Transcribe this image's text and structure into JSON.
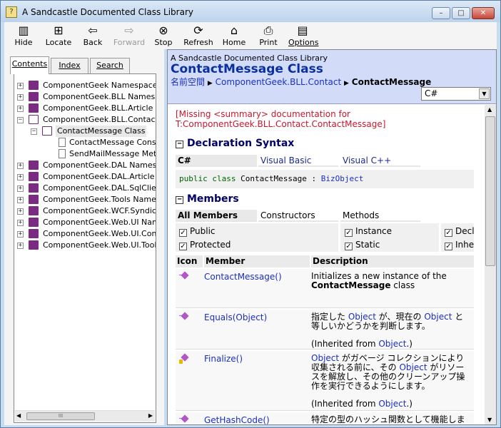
{
  "window": {
    "title": "A Sandcastle Documented Class Library",
    "icon": "help-book-icon",
    "minimize": "–",
    "maximize": "□",
    "close": "✕"
  },
  "toolbar": {
    "hide": "Hide",
    "locate": "Locate",
    "back": "Back",
    "forward": "Forward",
    "stop": "Stop",
    "refresh": "Refresh",
    "home": "Home",
    "print": "Print",
    "options": "Options"
  },
  "nav_tabs": {
    "contents": "Contents",
    "index": "Index",
    "search": "Search"
  },
  "tree": {
    "items": [
      {
        "label": "ComponentGeek Namespace"
      },
      {
        "label": "ComponentGeek.BLL Namespa"
      },
      {
        "label": "ComponentGeek.BLL.Article N"
      },
      {
        "label": "ComponentGeek.BLL.Contact N"
      },
      {
        "label": "ContactMessage Class"
      },
      {
        "label": "ContactMessage Cons"
      },
      {
        "label": "SendMailMessage Meth"
      },
      {
        "label": "ComponentGeek.DAL Namespa"
      },
      {
        "label": "ComponentGeek.DAL.Article N"
      },
      {
        "label": "ComponentGeek.DAL.SqlClient"
      },
      {
        "label": "ComponentGeek.Tools Namesp"
      },
      {
        "label": "ComponentGeek.WCF.Syndicat"
      },
      {
        "label": "ComponentGeek.Web.UI Names"
      },
      {
        "label": "ComponentGeek.Web.UI.Contro"
      },
      {
        "label": "ComponentGeek.Web.UI.Tools"
      }
    ],
    "scroll_grip": "III"
  },
  "topic": {
    "library": "A Sandcastle Documented Class Library",
    "title": "ContactMessage Class",
    "breadcrumb": {
      "root": "名前空間",
      "sep1": "▶",
      "namespace": "ComponentGeek.BLL.Contact",
      "sep2": "▶",
      "current": "ContactMessage"
    },
    "language": "C#",
    "missing": "[Missing <summary> documentation for T:ComponentGeek.BLL.Contact.ContactMessage]",
    "declaration": {
      "heading": "Declaration Syntax",
      "collapse": "−",
      "tabs": [
        "C#",
        "Visual Basic",
        "Visual C++"
      ],
      "code_kw1": "public",
      "code_kw2": "class",
      "code_name": "ContactMessage",
      "code_sep": ":",
      "code_base": "BizObject"
    },
    "members": {
      "heading": "Members",
      "collapse": "−",
      "tabs": [
        "All Members",
        "Constructors",
        "Methods"
      ],
      "filters": {
        "public": "Public",
        "protected": "Protected",
        "instance": "Instance",
        "static": "Static",
        "declared": "Decl",
        "inherited": "Inhe"
      },
      "columns": [
        "Icon",
        "Member",
        "Description"
      ],
      "rows": [
        {
          "name": "ContactMessage()",
          "desc1": "Initializes a new instance of the",
          "desc2": "ContactMessage",
          "desc3": "class"
        },
        {
          "name": "Equals(Object)",
          "d1": "指定した",
          "d1link": "Object",
          "d2": "が、現在の",
          "d2link": "Object",
          "d3": "と等しいかどうかを判断します。",
          "inh_prefix": "(Inherited from",
          "inh_link": "Object",
          "inh_suffix": ".)"
        },
        {
          "name": "Finalize()",
          "d1link": "Object",
          "d2": "がガベージ コレクションにより収集される前に、その",
          "d3link": "Object",
          "d4": "がリソースを解放し、その他のクリーンアップ操作を実行できるようにします。",
          "inh_prefix": "(Inherited from",
          "inh_link": "Object",
          "inh_suffix": ".)"
        },
        {
          "name": "GetHashCode()",
          "desc": "特定の型のハッシュ関数として機能します。"
        }
      ]
    }
  },
  "colors": {
    "title": "#0a2fa0",
    "link": "#1a2fc0",
    "missing": "#c8172c",
    "header_bg": "#d2dcf8"
  }
}
